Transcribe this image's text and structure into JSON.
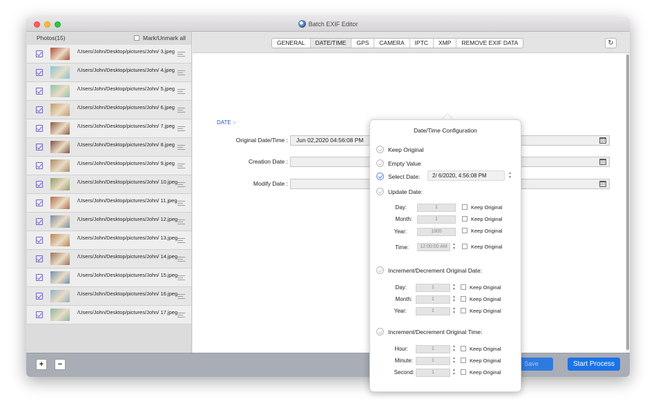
{
  "window": {
    "title": "Batch EXIF Editor"
  },
  "sidebar": {
    "header": "Photos(15)",
    "mark_all": "Mark/Unmark all",
    "photos": [
      {
        "path": "/Users/John/Desktop/pictures/John/ 3.jpeg",
        "color": "#b04a3c"
      },
      {
        "path": "/Users/John/Desktop/pictures/John/ 4.jpeg",
        "color": "#7fc7d8"
      },
      {
        "path": "/Users/John/Desktop/pictures/John/ 5.jpeg",
        "color": "#8fc4a9"
      },
      {
        "path": "/Users/John/Desktop/pictures/John/ 6.jpeg",
        "color": "#c49a6c"
      },
      {
        "path": "/Users/John/Desktop/pictures/John/ 7.jpeg",
        "color": "#8c5a3e"
      },
      {
        "path": "/Users/John/Desktop/pictures/John/ 8.jpeg",
        "color": "#7d5146"
      },
      {
        "path": "/Users/John/Desktop/pictures/John/ 9.jpeg",
        "color": "#a98a66"
      },
      {
        "path": "/Users/John/Desktop/pictures/John/ 10.jpeg",
        "color": "#8f9c6a"
      },
      {
        "path": "/Users/John/Desktop/pictures/John/ 11.jpeg",
        "color": "#b56a4a"
      },
      {
        "path": "/Users/John/Desktop/pictures/John/ 12.jpeg",
        "color": "#7b8aa0"
      },
      {
        "path": "/Users/John/Desktop/pictures/John/ 13.jpeg",
        "color": "#b88455"
      },
      {
        "path": "/Users/John/Desktop/pictures/John/ 14.jpeg",
        "color": "#9a7059"
      },
      {
        "path": "/Users/John/Desktop/pictures/John/ 15.jpeg",
        "color": "#6f8fb5"
      },
      {
        "path": "/Users/John/Desktop/pictures/John/ 16.jpeg",
        "color": "#8eb0c9"
      },
      {
        "path": "/Users/John/Desktop/pictures/John/ 17.jpeg",
        "color": "#8cb6a0"
      }
    ]
  },
  "tabs": [
    "GENERAL",
    "DATE/TIME",
    "GPS",
    "CAMERA",
    "IPTC",
    "XMP",
    "REMOVE EXIF DATA"
  ],
  "active_tab": "DATE/TIME",
  "date_section": {
    "label": "DATE :-",
    "original": {
      "label": "Original Date/Time :",
      "value": "Jun 02,2020 04:56:08 PM"
    },
    "creation": {
      "label": "Creation Date :",
      "value": ""
    },
    "modify": {
      "label": "Modify Date :",
      "value": ""
    }
  },
  "popover": {
    "title": "Date/Time Configuration",
    "keep_original": "Keep Original",
    "empty_value": "Empty Value",
    "select_date": "Select Date:",
    "select_date_value": "2/  6/2020,  4:56:08 PM",
    "update_date": {
      "label": "Update Date:",
      "day_label": "Day:",
      "day": "1",
      "month_label": "Month:",
      "month": "1",
      "year_label": "Year:",
      "year": "1905",
      "time_label": "Time:",
      "time": "12:00:00 AM"
    },
    "increment_date": {
      "label": "Increment/Decrement Original Date:",
      "day_label": "Day:",
      "day": "1",
      "month_label": "Month:",
      "month": "1",
      "year_label": "Year:",
      "year": "1"
    },
    "increment_time": {
      "label": "Increment/Decrement Original Time:",
      "hour_label": "Hour:",
      "hour": "1",
      "minute_label": "Minute:",
      "minute": "1",
      "second_label": "Second:",
      "second": "1"
    },
    "keep_original_checkbox": "Keep Original"
  },
  "bottom": {
    "add": "+",
    "remove": "−",
    "save": "Save",
    "start": "Start Process"
  }
}
